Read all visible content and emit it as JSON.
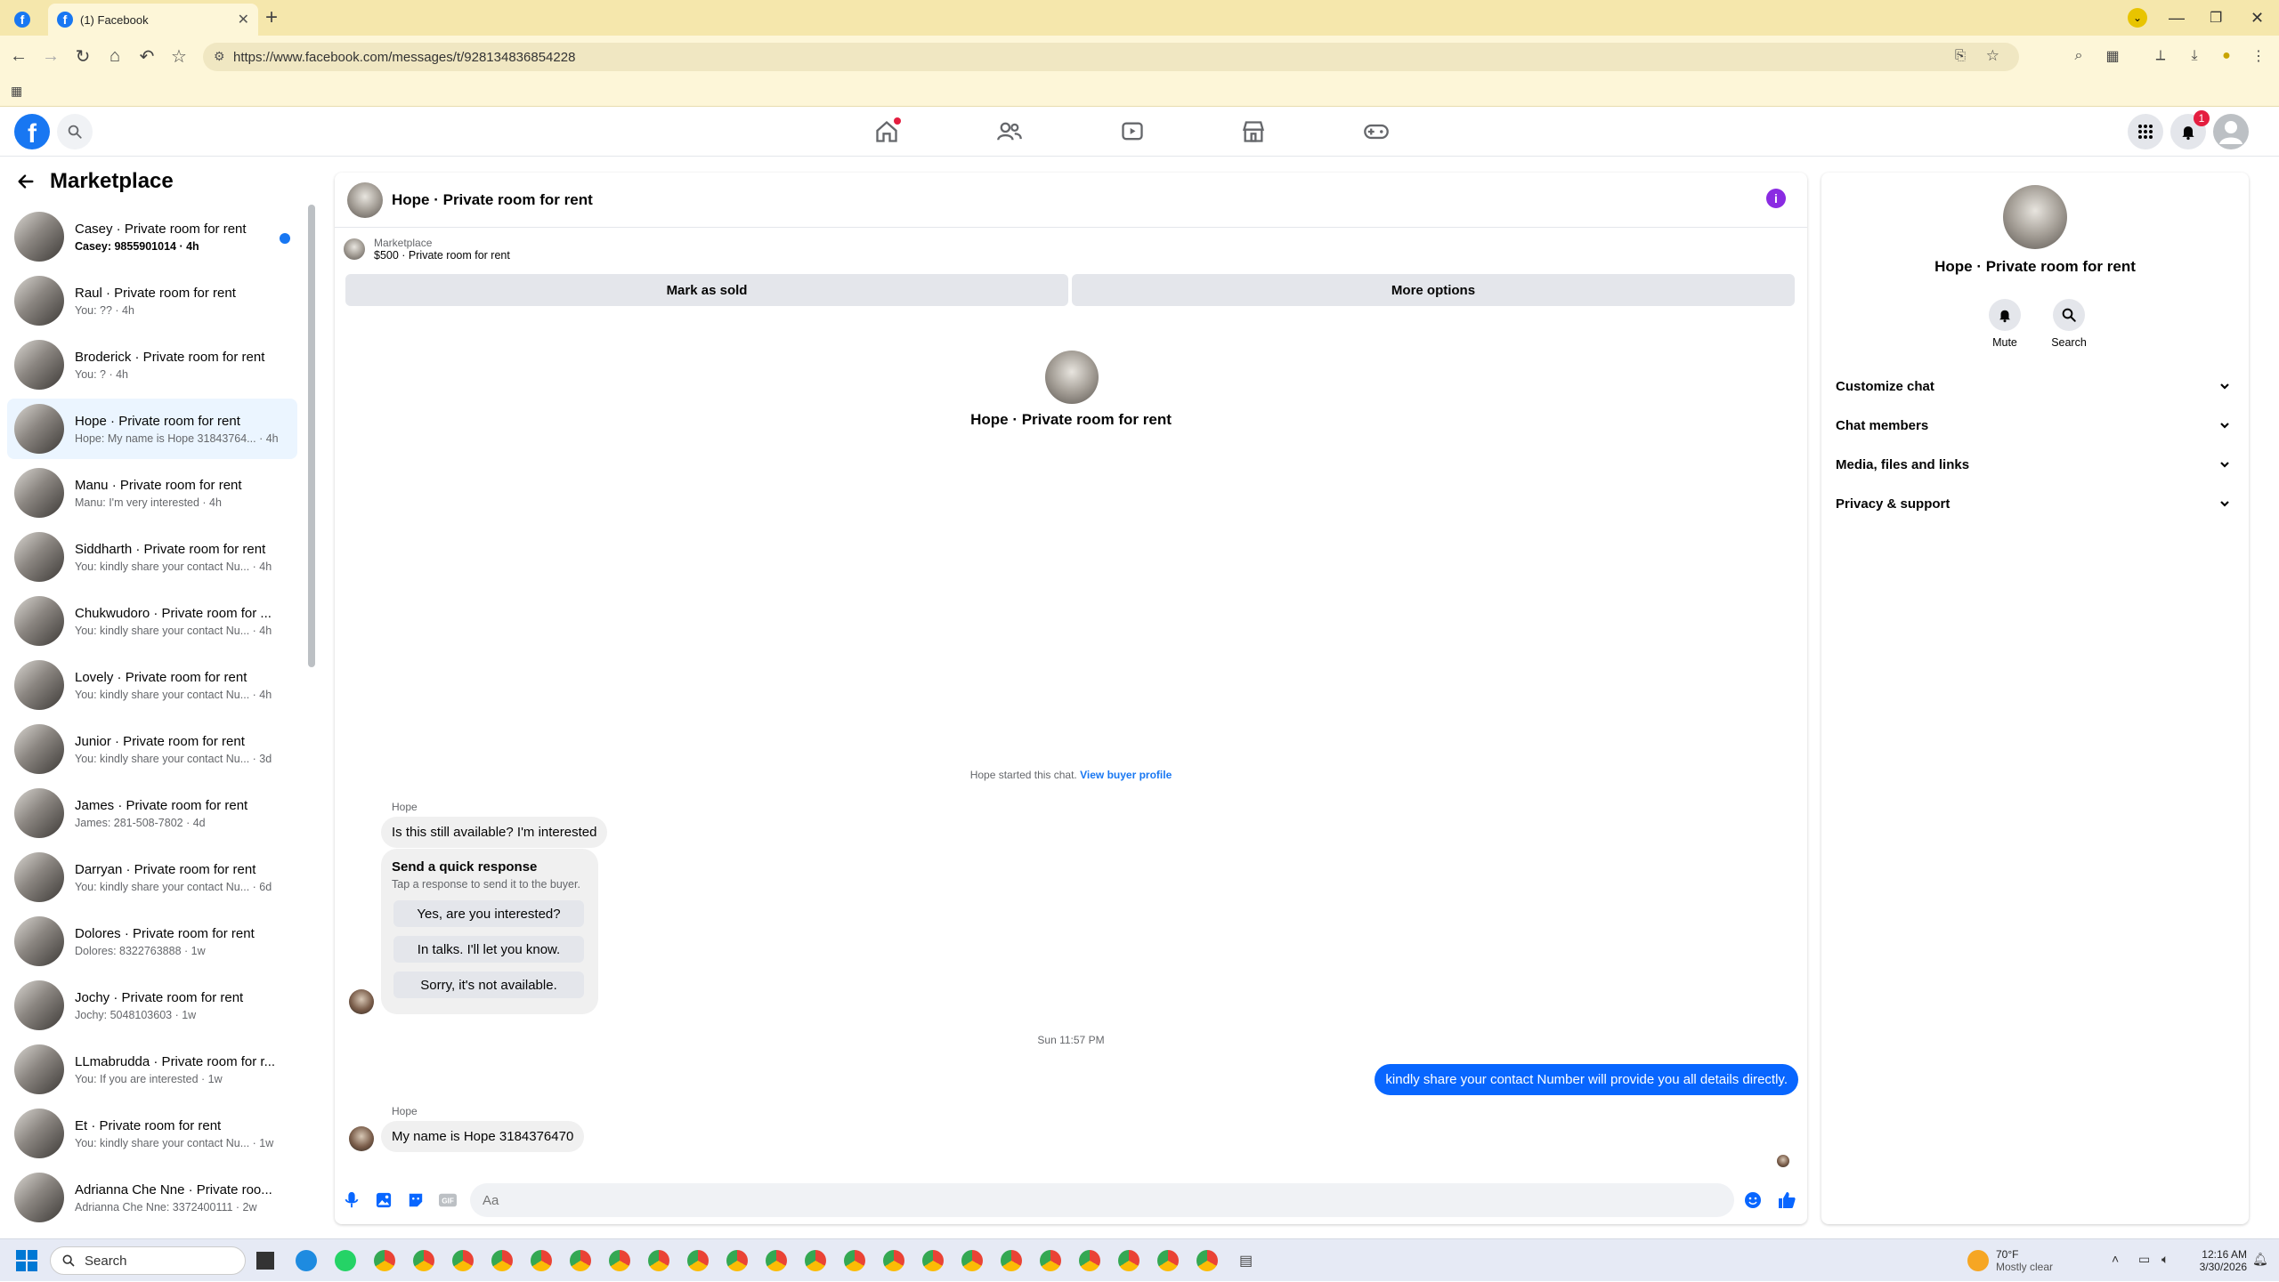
{
  "browser": {
    "tab_title": "(1) Facebook",
    "url": "https://www.facebook.com/messages/t/928134836854228"
  },
  "fb": {
    "notification_count": "1"
  },
  "sidebar": {
    "title": "Marketplace",
    "conversations": [
      {
        "name": "Casey · Private room for rent",
        "preview": "Casey: 9855901014 · 4h",
        "unread": true
      },
      {
        "name": "Raul · Private room for rent",
        "preview": "You: ?? · 4h"
      },
      {
        "name": "Broderick · Private room for rent",
        "preview": "You: ? · 4h"
      },
      {
        "name": "Hope · Private room for rent",
        "preview": "Hope: My name is Hope 31843764... · 4h",
        "selected": true
      },
      {
        "name": "Manu · Private room for rent",
        "preview": "Manu: I'm very interested · 4h"
      },
      {
        "name": "Siddharth · Private room for rent",
        "preview": "You: kindly share your contact Nu... · 4h"
      },
      {
        "name": "Chukwudoro · Private room for ...",
        "preview": "You: kindly share your contact Nu... · 4h"
      },
      {
        "name": "Lovely · Private room for rent",
        "preview": "You: kindly share your contact Nu... · 4h"
      },
      {
        "name": "Junior · Private room for rent",
        "preview": "You: kindly share your contact Nu... · 3d"
      },
      {
        "name": "James · Private room for rent",
        "preview": "James: 281-508-7802 · 4d"
      },
      {
        "name": "Darryan · Private room for rent",
        "preview": "You: kindly share your contact Nu... · 6d"
      },
      {
        "name": "Dolores · Private room for rent",
        "preview": "Dolores: 8322763888 · 1w"
      },
      {
        "name": "Jochy · Private room for rent",
        "preview": "Jochy: 5048103603 · 1w"
      },
      {
        "name": "LLmabrudda · Private room for r...",
        "preview": "You: If you are interested · 1w"
      },
      {
        "name": "Et · Private room for rent",
        "preview": "You: kindly share your contact Nu... · 1w"
      },
      {
        "name": "Adrianna Che Nne · Private roo...",
        "preview": "Adrianna Che Nne: 3372400111 · 2w"
      }
    ]
  },
  "chat": {
    "title": "Hope · Private room for rent",
    "marketplace_label": "Marketplace",
    "listing": "$500 · Private room for rent",
    "mark_sold": "Mark as sold",
    "more_options": "More options",
    "center_name": "Hope · Private room for rent",
    "started_text": "Hope started this chat.",
    "view_profile": "View buyer profile",
    "sender1": "Hope",
    "msg1": "Is this still available? I'm interested",
    "qr_title": "Send a quick response",
    "qr_sub": "Tap a response to send it to the buyer.",
    "qr_options": [
      "Yes, are you interested?",
      "In talks. I'll let you know.",
      "Sorry, it's not available."
    ],
    "timestamp": "Sun 11:57 PM",
    "msg_out": "kindly share your contact Number will provide you all details directly.",
    "sender2": "Hope",
    "msg2": "My name is Hope 3184376470",
    "composer_placeholder": "Aa"
  },
  "right_panel": {
    "name": "Hope · Private room for rent",
    "mute": "Mute",
    "search": "Search",
    "sections": [
      "Customize chat",
      "Chat members",
      "Media, files and links",
      "Privacy & support"
    ]
  },
  "taskbar": {
    "search_placeholder": "Search",
    "weather_temp": "70°F",
    "weather_desc": "Mostly clear",
    "time": "12:16 AM",
    "date": "3/30/2026"
  }
}
